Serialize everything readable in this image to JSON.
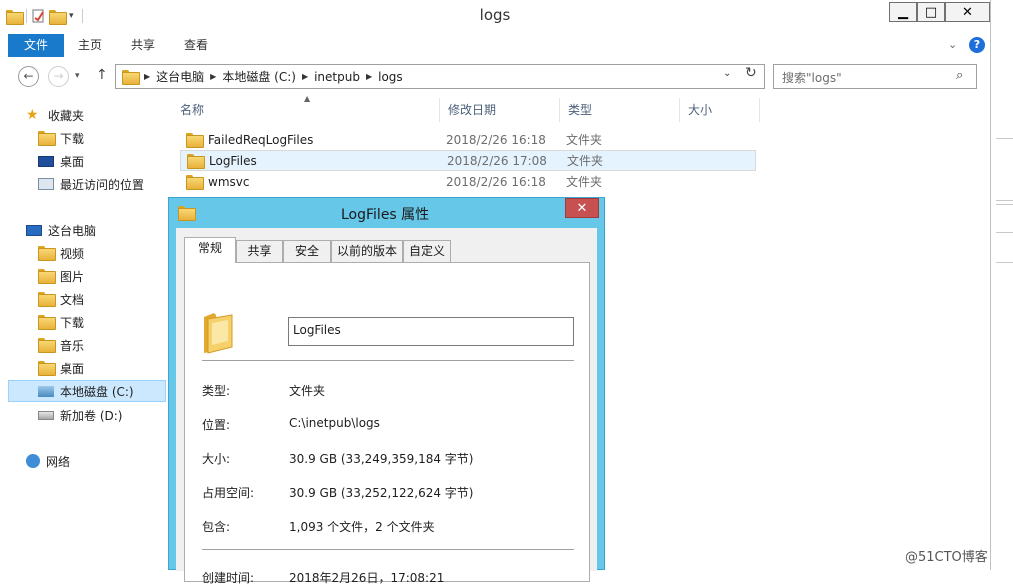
{
  "window": {
    "title": "logs",
    "minimize": "▁",
    "maximize": "□",
    "close": "✕"
  },
  "ribbon": {
    "tabs": [
      "文件",
      "主页",
      "共享",
      "查看"
    ],
    "expand": "⌄",
    "help": "?"
  },
  "navbar": {
    "back": "←",
    "forward": "→",
    "recent": "▾",
    "up": "↑",
    "breadcrumb": [
      "这台电脑",
      "本地磁盘 (C:)",
      "inetpub",
      "logs"
    ],
    "dropdown": "⌄",
    "refresh": "↻",
    "search_placeholder": "搜索\"logs\"",
    "search_icon": "⌕"
  },
  "navpane": {
    "items": [
      {
        "label": "收藏夹",
        "icon": "star-icon"
      },
      {
        "label": "下载",
        "icon": "download-folder-icon"
      },
      {
        "label": "桌面",
        "icon": "desktop-icon"
      },
      {
        "label": "最近访问的位置",
        "icon": "recent-places-icon"
      },
      {
        "label": "这台电脑",
        "icon": "computer-icon"
      },
      {
        "label": "视频",
        "icon": "videos-folder-icon"
      },
      {
        "label": "图片",
        "icon": "pictures-folder-icon"
      },
      {
        "label": "文档",
        "icon": "documents-folder-icon"
      },
      {
        "label": "下载",
        "icon": "download-folder-icon"
      },
      {
        "label": "音乐",
        "icon": "music-folder-icon"
      },
      {
        "label": "桌面",
        "icon": "desktop-folder-icon"
      },
      {
        "label": "本地磁盘 (C:)",
        "icon": "drive-c-icon"
      },
      {
        "label": "新加卷 (D:)",
        "icon": "drive-d-icon"
      },
      {
        "label": "网络",
        "icon": "network-icon"
      }
    ],
    "selected_index": 11
  },
  "filelist": {
    "columns": [
      "名称",
      "修改日期",
      "类型",
      "大小"
    ],
    "sort_indicator": "▲",
    "rows": [
      {
        "name": "FailedReqLogFiles",
        "date": "2018/2/26 16:18",
        "type": "文件夹"
      },
      {
        "name": "LogFiles",
        "date": "2018/2/26 17:08",
        "type": "文件夹"
      },
      {
        "name": "wmsvc",
        "date": "2018/2/26 16:18",
        "type": "文件夹"
      }
    ],
    "selected_index": 1
  },
  "dialog": {
    "title": "LogFiles 属性",
    "close": "✕",
    "tabs": [
      "常规",
      "共享",
      "安全",
      "以前的版本",
      "自定义"
    ],
    "active_tab": "常规",
    "name_value": "LogFiles",
    "properties": {
      "type_label": "类型:",
      "type_value": "文件夹",
      "location_label": "位置:",
      "location_value": "C:\\inetpub\\logs",
      "size_label": "大小:",
      "size_value": "30.9 GB (33,249,359,184 字节)",
      "disk_label": "占用空间:",
      "disk_value": "30.9 GB (33,252,122,624 字节)",
      "contains_label": "包含:",
      "contains_value": "1,093 个文件，2 个文件夹",
      "created_label": "创建时间:",
      "created_value": "2018年2月26日，17:08:21"
    }
  },
  "watermark": "@51CTO博客",
  "colors": {
    "accent": "#1979ca",
    "dialog_frame": "#67c7e9",
    "close_red": "#c75050",
    "selection": "#cce8ff"
  }
}
